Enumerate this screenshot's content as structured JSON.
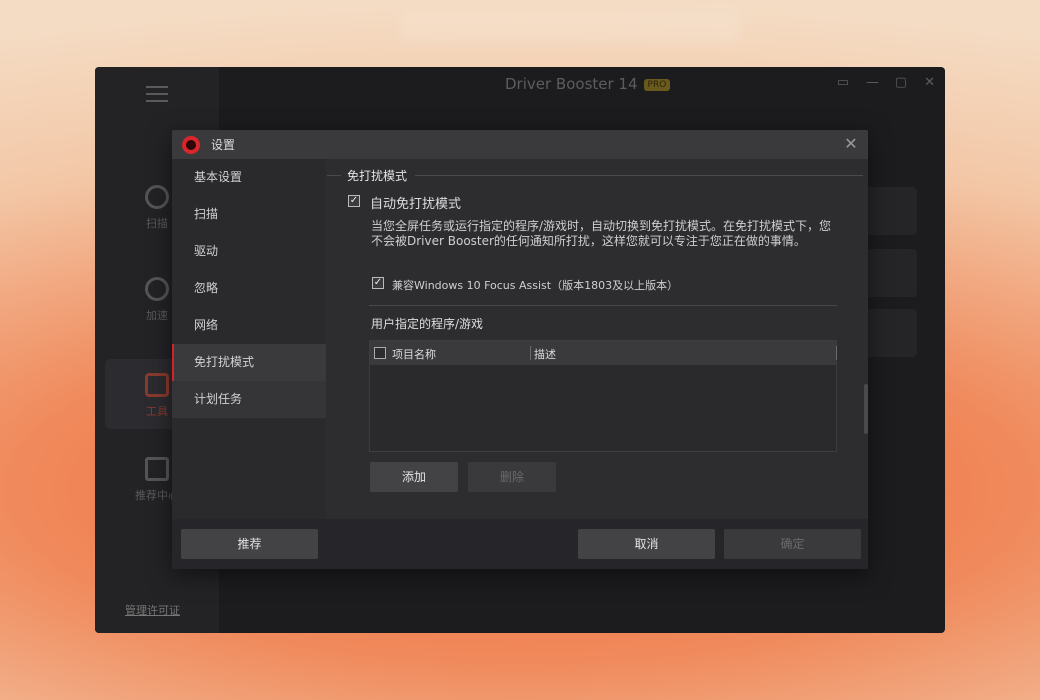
{
  "app": {
    "title": "Driver Booster 14",
    "badge": "PRO",
    "sidebar": [
      {
        "label": "扫描",
        "icon": "scan-icon"
      },
      {
        "label": "加速",
        "icon": "boost-icon"
      },
      {
        "label": "工具",
        "icon": "toolbox-icon"
      },
      {
        "label": "推荐中心",
        "icon": "apps-icon"
      }
    ],
    "license_link": "管理许可证",
    "window_controls": {
      "feedback": "feedback-icon",
      "minimize": "—",
      "maximize": "▢",
      "close": "✕"
    }
  },
  "dialog": {
    "title": "设置",
    "close": "✕",
    "nav": [
      {
        "label": "基本设置"
      },
      {
        "label": "扫描"
      },
      {
        "label": "驱动"
      },
      {
        "label": "忽略"
      },
      {
        "label": "网络"
      },
      {
        "label": "免打扰模式"
      },
      {
        "label": "计划任务"
      }
    ],
    "active_nav": "免打扰模式",
    "section": {
      "heading": "免打扰模式",
      "auto_label": "自动免打扰模式",
      "auto_checked": true,
      "description": "当您全屏任务或运行指定的程序/游戏时，自动切换到免打扰模式。在免打扰模式下，您不会被Driver Booster的任何通知所打扰，这样您就可以专注于您正在做的事情。",
      "compat_label": "兼容Windows 10 Focus Assist（版本1803及以上版本）",
      "compat_checked": true,
      "user_list_label": "用户指定的程序/游戏",
      "table": {
        "col_name": "项目名称",
        "col_desc": "描述",
        "rows": []
      },
      "add_button": "添加",
      "delete_button": "删除"
    },
    "footer": {
      "recommend_button": "推荐",
      "cancel_button": "取消",
      "ok_button": "确定"
    }
  }
}
